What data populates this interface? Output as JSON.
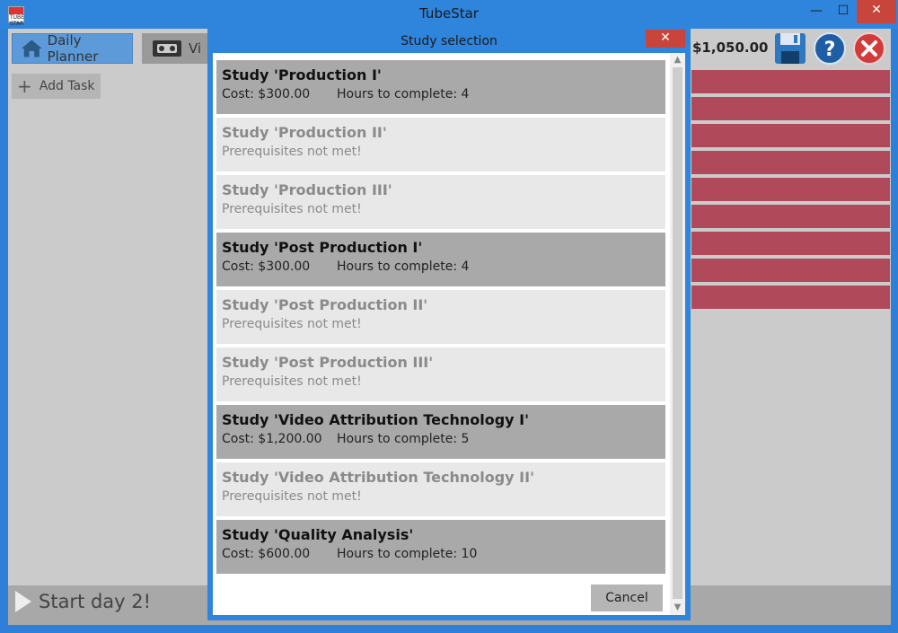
{
  "window": {
    "title": "TubeStar",
    "icon_text": "TUBE STAR",
    "min_glyph": "—",
    "max_glyph": "☐",
    "close_glyph": "✕"
  },
  "nav": {
    "daily_planner": "Daily Planner",
    "video_label": "Vi"
  },
  "add_task": {
    "plus": "+",
    "label": "Add Task"
  },
  "money": "$1,050.00",
  "start_day": "Start day 2!",
  "colors": {
    "accent_blue": "#2f84dc",
    "close_red": "#c7453b",
    "bar_red": "#b0495a",
    "available_bg": "#a9a9a9",
    "locked_bg": "#e8e8e8"
  },
  "dialog": {
    "title": "Study selection",
    "close_glyph": "✕",
    "cancel_label": "Cancel",
    "scroll_up": "▲",
    "scroll_down": "▼",
    "items": [
      {
        "name": "Study 'Production I'",
        "available": true,
        "cost": "Cost: $300.00",
        "hours": "Hours to complete: 4"
      },
      {
        "name": "Study 'Production II'",
        "available": false,
        "status": "Prerequisites not met!"
      },
      {
        "name": "Study 'Production III'",
        "available": false,
        "status": "Prerequisites not met!"
      },
      {
        "name": "Study 'Post Production I'",
        "available": true,
        "cost": "Cost: $300.00",
        "hours": "Hours to complete: 4"
      },
      {
        "name": "Study 'Post Production II'",
        "available": false,
        "status": "Prerequisites not met!"
      },
      {
        "name": "Study 'Post Production III'",
        "available": false,
        "status": "Prerequisites not met!"
      },
      {
        "name": "Study 'Video Attribution Technology I'",
        "available": true,
        "cost": "Cost: $1,200.00",
        "hours": "Hours to complete: 5"
      },
      {
        "name": "Study 'Video Attribution Technology II'",
        "available": false,
        "status": "Prerequisites not met!"
      },
      {
        "name": "Study 'Quality Analysis'",
        "available": true,
        "cost": "Cost: $600.00",
        "hours": "Hours to complete: 10"
      }
    ]
  },
  "icons": [
    "home-icon",
    "vhs-tape-icon",
    "plus-icon",
    "save-icon",
    "help-icon",
    "exit-icon",
    "play-icon"
  ]
}
